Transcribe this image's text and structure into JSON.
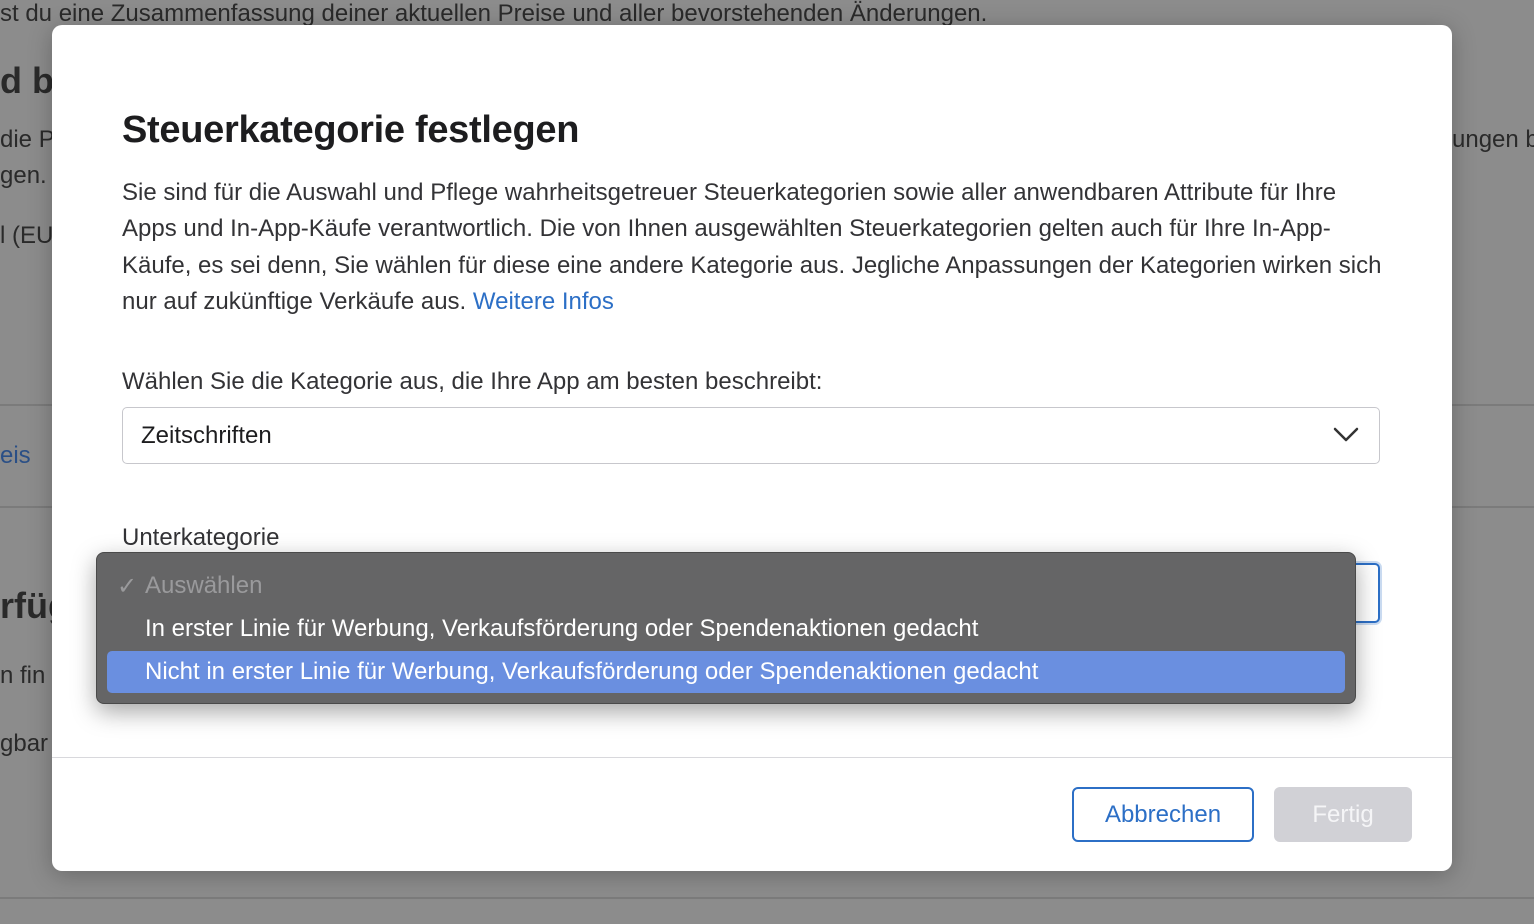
{
  "background": {
    "line1": "st du eine Zusammenfassung deiner aktuellen Preise und aller bevorstehenden Änderungen.",
    "frag_heading": "d bz",
    "frag_left1": "die P",
    "frag_left2": "gen.",
    "frag_left3": "l (EU",
    "frag_right1": "ungen b",
    "frag_link": "eis",
    "frag_heading2": "rfüg",
    "frag_left4": "n fin",
    "frag_left5": "gbar"
  },
  "modal": {
    "title": "Steuerkategorie festlegen",
    "description": "Sie sind für die Auswahl und Pflege wahrheitsgetreuer Steuerkategorien sowie aller anwendbaren Attribute für Ihre Apps und In-App-Käufe verantwortlich. Die von Ihnen ausgewählten Steuerkategorien gelten auch für Ihre In-App-Käufe, es sei denn, Sie wählen für diese eine andere Kategorie aus. Jegliche Anpassungen der Kategorien wirken sich nur auf zukünftige Verkäufe aus.",
    "learn_more": "Weitere Infos",
    "category_label": "Wählen Sie die Kategorie aus, die Ihre App am besten beschreibt:",
    "category_value": "Zeitschriften",
    "subcategory_label": "Unterkategorie",
    "subcategory_options": [
      {
        "label": "Auswählen",
        "check": "✓",
        "state": "disabled"
      },
      {
        "label": "In erster Linie für Werbung, Verkaufsförderung oder Spendenaktionen gedacht",
        "state": "normal"
      },
      {
        "label": "Nicht in erster Linie für Werbung, Verkaufsförderung oder Spendenaktionen gedacht",
        "state": "highlighted"
      }
    ],
    "cancel_label": "Abbrechen",
    "done_label": "Fertig"
  },
  "colors": {
    "accent": "#2c6fc6",
    "highlight": "#6a8fe0",
    "popup_bg": "#656566",
    "disabled_button": "#d1d1d6"
  },
  "icons": {
    "select_arrow": "chevron-down-icon",
    "option_check": "checkmark-icon"
  }
}
